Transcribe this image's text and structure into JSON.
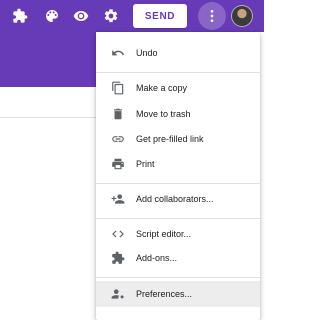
{
  "header": {
    "accent_color": "#673ab7",
    "icons": [
      "puzzle-icon",
      "palette-icon",
      "eye-icon",
      "gear-icon"
    ],
    "send_label": "SEND",
    "more_icon": "more-vert-icon"
  },
  "menu": {
    "items": [
      {
        "label": "Undo",
        "icon": "undo-icon"
      },
      {
        "label": "Make a copy",
        "icon": "copy-icon"
      },
      {
        "label": "Move to trash",
        "icon": "trash-icon"
      },
      {
        "label": "Get pre-filled link",
        "icon": "link-icon"
      },
      {
        "label": "Print",
        "icon": "print-icon"
      },
      {
        "label": "Add collaborators...",
        "icon": "add-people-icon"
      },
      {
        "label": "Script editor...",
        "icon": "code-icon"
      },
      {
        "label": "Add-ons...",
        "icon": "puzzle-icon"
      },
      {
        "label": "Preferences...",
        "icon": "person-settings-icon",
        "highlighted": true
      }
    ]
  }
}
